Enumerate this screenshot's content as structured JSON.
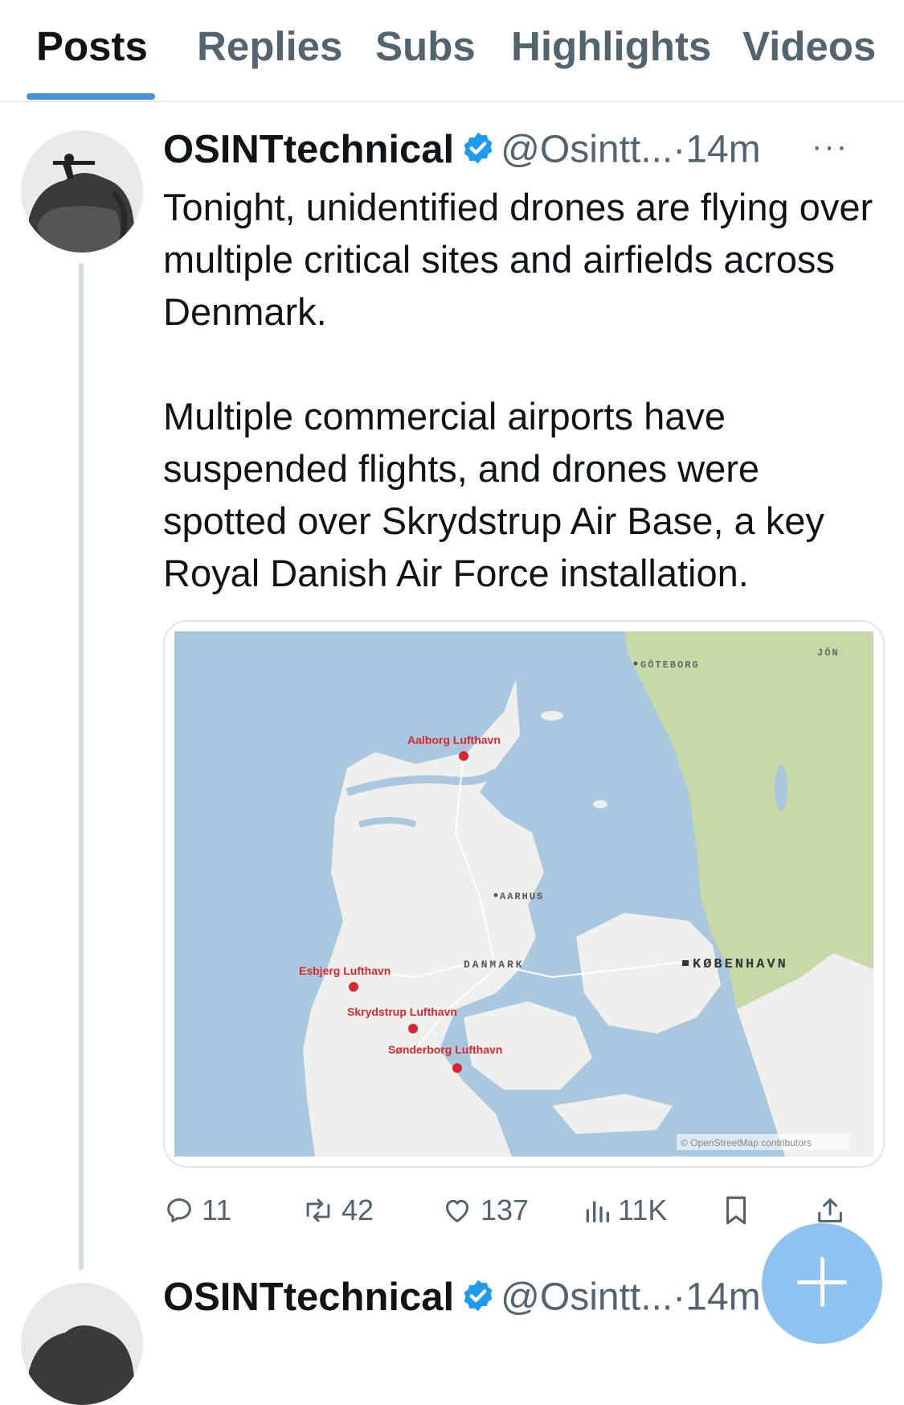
{
  "tabs": [
    {
      "label": "Posts",
      "active": true
    },
    {
      "label": "Replies"
    },
    {
      "label": "Subs"
    },
    {
      "label": "Highlights"
    },
    {
      "label": "Videos"
    }
  ],
  "post": {
    "author": "OSINTtechnical",
    "handle": "@Osintt...",
    "separator": "·",
    "time": "14m",
    "more": "···",
    "paragraphs": [
      "Tonight, unidentified drones are flying over multiple critical sites and airfields across Denmark.",
      "Multiple commercial airports have suspended flights, and drones were spotted over Skrydstrup Air Base, a key Royal Danish Air Force installation."
    ],
    "map": {
      "labels": {
        "aalborg": "Aalborg Lufthavn",
        "esbjerg": "Esbjerg Lufthavn",
        "skrydstrup": "Skrydstrup Lufthavn",
        "sonderborg": "Sønderborg Lufthavn",
        "goteborg": "GÖTEBORG",
        "jon": "JÖN",
        "aarhus": "AARHUS",
        "danmark": "DANMARK",
        "kobenhavn": "KØBENHAVN",
        "attribution": "© OpenStreetMap contributors"
      },
      "colors": {
        "sea": "#a9c8df",
        "land": "#efefed",
        "forest": "#c8d9a8",
        "marker": "#d9262d"
      }
    },
    "actions": {
      "replies": "11",
      "reposts": "42",
      "likes": "137",
      "views": "11K"
    }
  },
  "next_post": {
    "author": "OSINTtechnical",
    "handle": "@Osintt...",
    "separator": "·",
    "time": "14m",
    "more": "···"
  },
  "icons": [
    "verified-badge-icon",
    "reply-icon",
    "repost-icon",
    "like-icon",
    "views-icon",
    "bookmark-icon",
    "share-icon",
    "plus-icon"
  ],
  "accent": "#1d9bf0"
}
